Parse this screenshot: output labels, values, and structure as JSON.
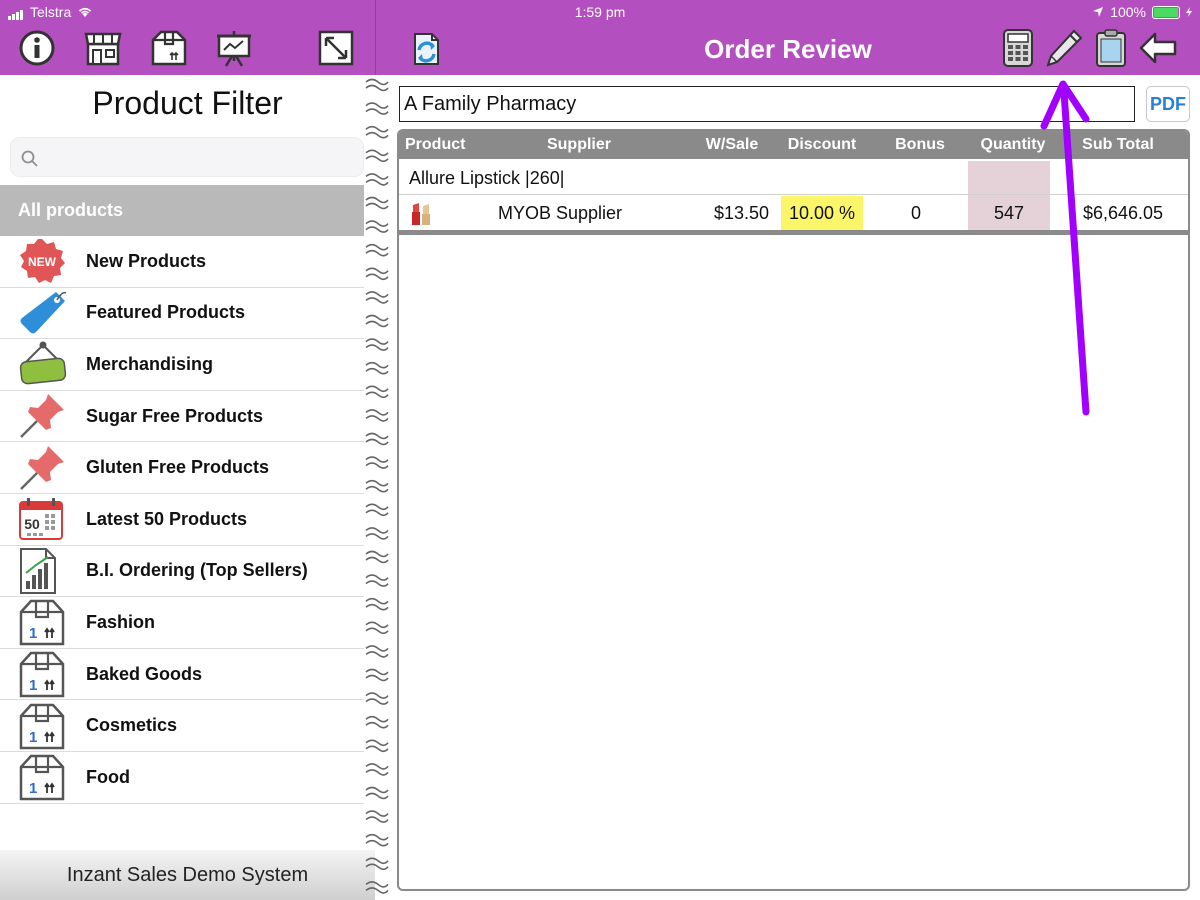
{
  "status": {
    "carrier": "Telstra",
    "time": "1:59 pm",
    "battery": "100%"
  },
  "header": {
    "title": "Order Review"
  },
  "sidebar": {
    "title": "Product Filter",
    "search_placeholder": "",
    "all_products_label": "All products",
    "items": [
      {
        "label": "New Products",
        "icon": "new-badge-icon"
      },
      {
        "label": "Featured Products",
        "icon": "tag-icon"
      },
      {
        "label": "Merchandising",
        "icon": "hanging-sign-icon"
      },
      {
        "label": "Sugar Free Products",
        "icon": "pushpin-icon"
      },
      {
        "label": "Gluten Free Products",
        "icon": "pushpin-icon"
      },
      {
        "label": "Latest 50 Products",
        "icon": "calendar-icon"
      },
      {
        "label": "B.I. Ordering (Top Sellers)",
        "icon": "bar-chart-icon"
      },
      {
        "label": "Fashion",
        "icon": "box-icon"
      },
      {
        "label": "Baked Goods",
        "icon": "box-icon"
      },
      {
        "label": "Cosmetics",
        "icon": "box-icon"
      },
      {
        "label": "Food",
        "icon": "box-icon"
      }
    ],
    "calendar_number": "50",
    "new_badge_text": "NEW",
    "footer": "Inzant Sales Demo System"
  },
  "order": {
    "customer": "A Family Pharmacy",
    "pdf_label": "PDF",
    "columns": [
      "Product",
      "Supplier",
      "W/Sale",
      "Discount",
      "Bonus",
      "Quantity",
      "Sub Total"
    ],
    "group_name": "Allure Lipstick |260|",
    "rows": [
      {
        "supplier": "MYOB Supplier",
        "wsale": "$13.50",
        "discount": "10.00 %",
        "bonus": "0",
        "quantity": "547",
        "subtotal": "$6,646.05"
      }
    ]
  },
  "colors": {
    "accent": "#b44fbf",
    "annotation_arrow": "#a100ff",
    "discount_highlight": "#fbf56a",
    "quantity_highlight": "#e4d2d8"
  }
}
